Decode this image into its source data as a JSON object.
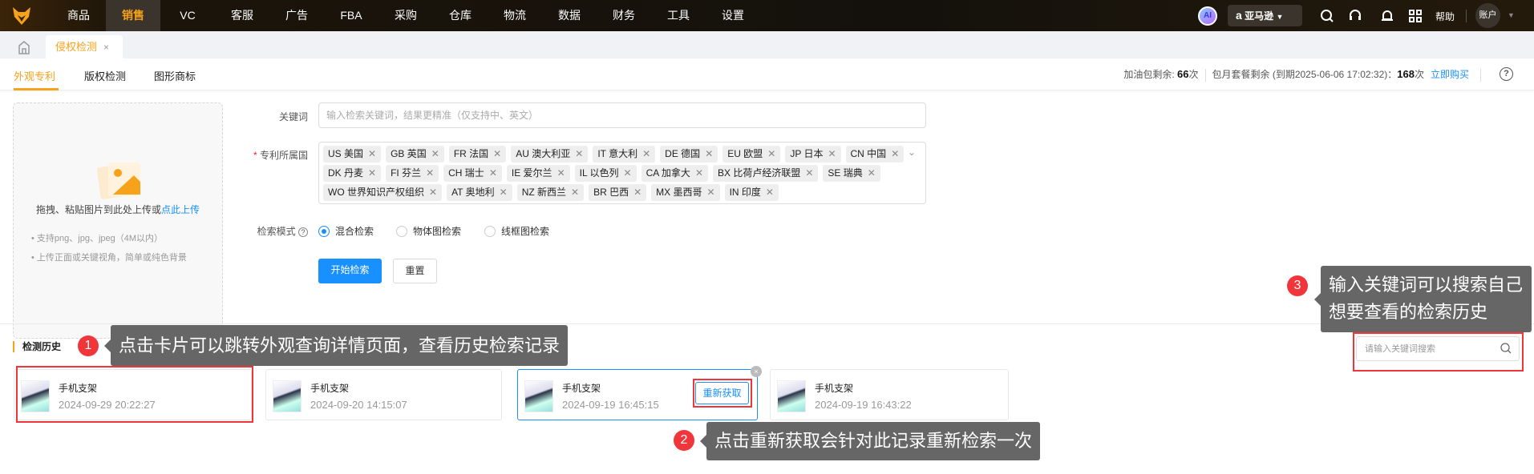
{
  "nav": {
    "items": [
      "商品",
      "销售",
      "VC",
      "客服",
      "广告",
      "FBA",
      "采购",
      "仓库",
      "物流",
      "数据",
      "财务",
      "工具",
      "设置"
    ],
    "active": 1,
    "ai_label": "AI",
    "marketplace": "亚马逊",
    "help": "帮助",
    "account": "账户"
  },
  "tabs": {
    "page_tab": "侵权检测",
    "close": "×"
  },
  "subtabs": {
    "items": [
      "外观专利",
      "版权检测",
      "图形商标"
    ],
    "active": 0
  },
  "quota": {
    "addon_label": "加油包剩余:",
    "addon_value": "66",
    "unit": "次",
    "monthly_label": "包月套餐剩余 (到期2025-06-06 17:02:32)：",
    "monthly_value": "168",
    "buy": "立即购买"
  },
  "upload": {
    "text": "拖拽、粘贴图片到此处上传或",
    "link": "点此上传",
    "tips": [
      "• 支持png、jpg、jpeg（4M以内）",
      "• 上传正面或关键视角，简单或纯色背景"
    ]
  },
  "form": {
    "keyword_label": "关键词",
    "keyword_placeholder": "输入检索关键词，结果更精准（仅支持中、英文）",
    "country_label": "专利所属国",
    "required": "*",
    "country_rows": [
      [
        "US 美国",
        "GB 英国",
        "FR 法国",
        "AU 澳大利亚",
        "IT 意大利",
        "DE 德国",
        "EU 欧盟",
        "JP 日本",
        "CN 中国"
      ],
      [
        "DK 丹麦",
        "FI 芬兰",
        "CH 瑞士",
        "IE 爱尔兰",
        "IL 以色列",
        "CA 加拿大",
        "BX 比荷卢经济联盟",
        "SE 瑞典"
      ],
      [
        "WO 世界知识产权组织",
        "AT 奥地利",
        "NZ 新西兰",
        "BR 巴西",
        "MX 墨西哥",
        "IN 印度"
      ]
    ],
    "mode_label": "检索模式",
    "modes": [
      "混合检索",
      "物体图检索",
      "线框图检索"
    ],
    "mode_selected": 0,
    "search_btn": "开始检索",
    "reset_btn": "重置"
  },
  "history": {
    "title": "检测历史",
    "search_placeholder": "请输入关键词搜索",
    "refetch": "重新获取",
    "close": "×",
    "cards": [
      {
        "name": "手机支架",
        "time": "2024-09-29 20:22:27"
      },
      {
        "name": "手机支架",
        "time": "2024-09-20 14:15:07"
      },
      {
        "name": "手机支架",
        "time": "2024-09-19 16:45:15"
      },
      {
        "name": "手机支架",
        "time": "2024-09-19 16:43:22"
      }
    ]
  },
  "annotations": [
    {
      "num": "1",
      "text": "点击卡片可以跳转外观查询详情页面，查看历史检索记录"
    },
    {
      "num": "2",
      "text": "点击重新获取会针对此记录重新检索一次"
    },
    {
      "num": "3",
      "text": "输入关键词可以搜索自己想要查看的检索历史"
    }
  ]
}
